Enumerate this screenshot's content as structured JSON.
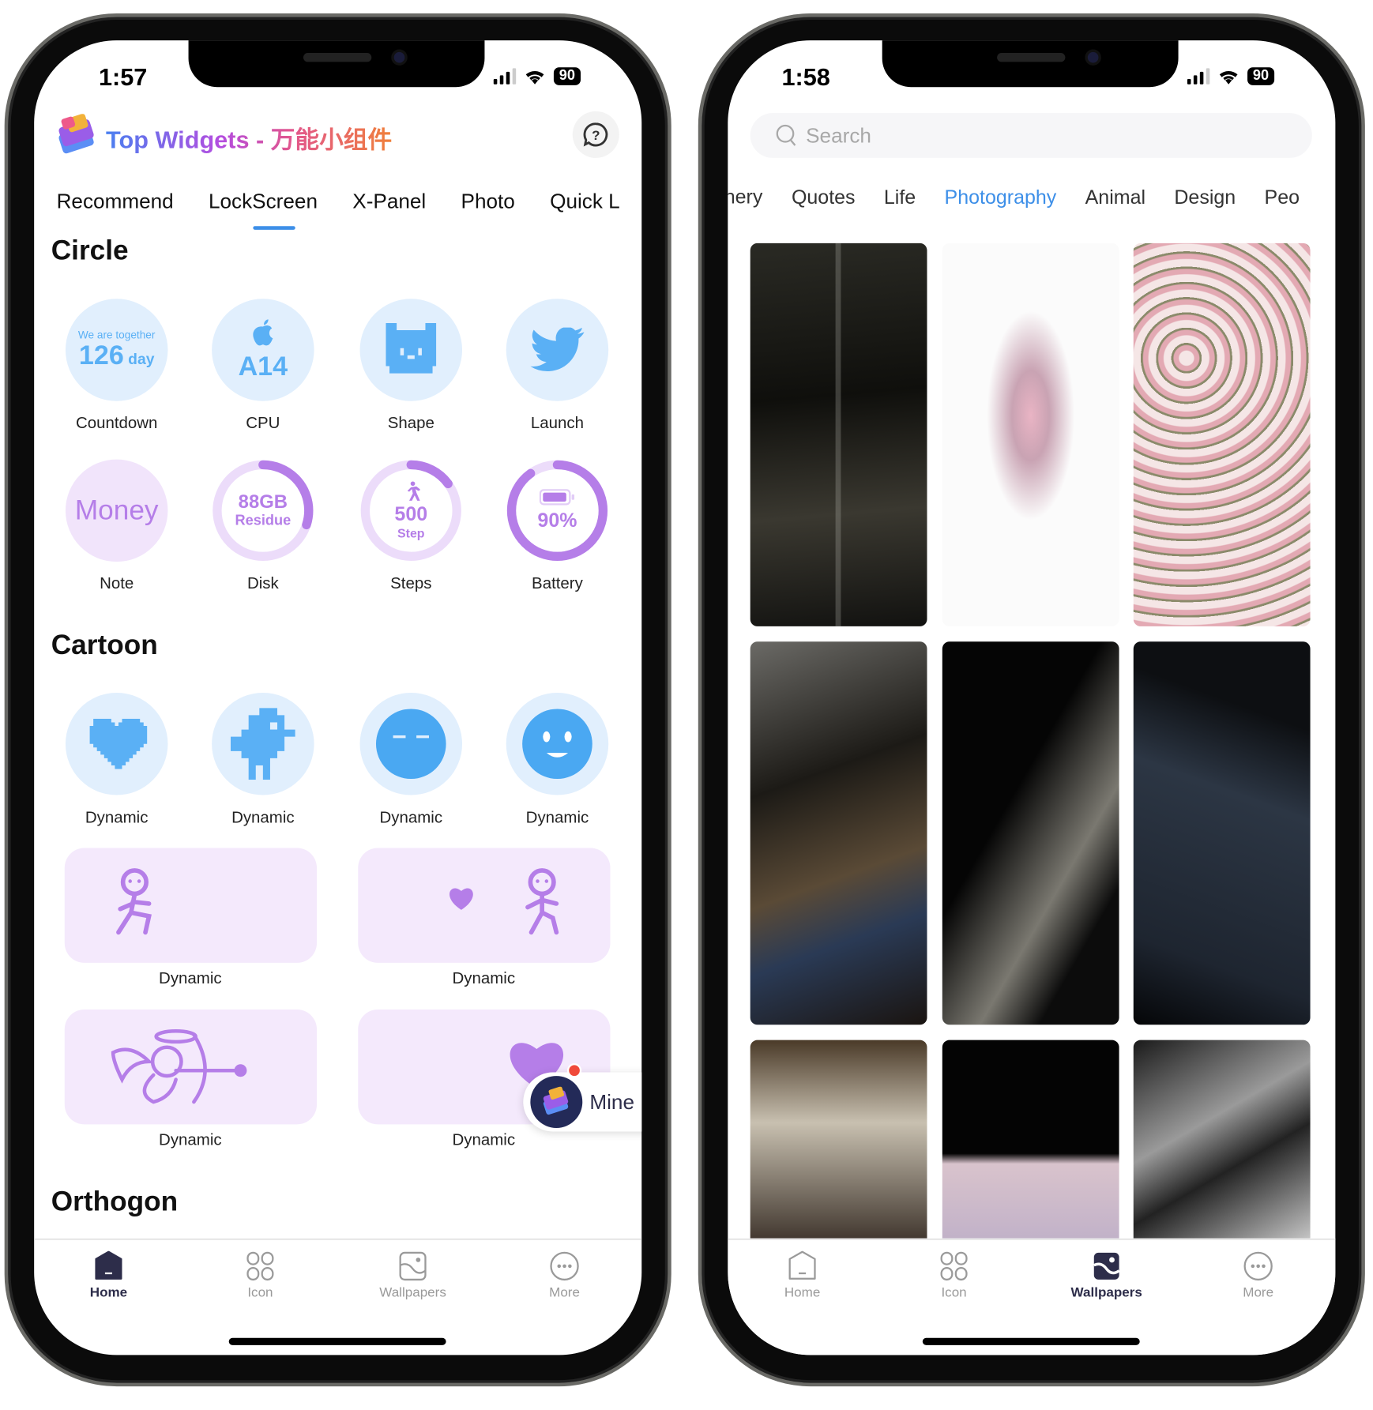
{
  "left": {
    "status": {
      "time": "1:57",
      "battery": "90"
    },
    "app_title": "Top Widgets - 万能小组件",
    "tabs": [
      {
        "label": "Recommend"
      },
      {
        "label": "LockScreen",
        "active": true
      },
      {
        "label": "X-Panel"
      },
      {
        "label": "Photo"
      },
      {
        "label": "Quick L"
      }
    ],
    "sections": {
      "circle": "Circle",
      "cartoon": "Cartoon",
      "orthogon": "Orthogon"
    },
    "circle_widgets": [
      {
        "label": "Countdown",
        "line1": "We are together",
        "value": "126",
        "unit": "day"
      },
      {
        "label": "CPU",
        "value": "A14",
        "icon": "apple-icon"
      },
      {
        "label": "Shape",
        "icon": "pixel-cat-icon"
      },
      {
        "label": "Launch",
        "icon": "twitter-bird-icon"
      },
      {
        "label": "Note",
        "value": "Money"
      },
      {
        "label": "Disk",
        "value": "88GB",
        "sub": "Residue",
        "progress": 0.3
      },
      {
        "label": "Steps",
        "value": "500",
        "sub": "Step",
        "progress": 0.15,
        "icon": "walking-icon"
      },
      {
        "label": "Battery",
        "value": "90%",
        "progress": 0.9,
        "icon": "battery-icon"
      }
    ],
    "cartoon_widgets": [
      {
        "label": "Dynamic",
        "icon": "pixel-heart-icon"
      },
      {
        "label": "Dynamic",
        "icon": "pixel-bird-icon"
      },
      {
        "label": "Dynamic",
        "icon": "sleepy-face-icon"
      },
      {
        "label": "Dynamic",
        "icon": "smiley-face-icon"
      }
    ],
    "wide_widgets": [
      {
        "label": "Dynamic",
        "icon": "dancing-figure-icon"
      },
      {
        "label": "Dynamic",
        "icon": "figure-heart-icon"
      },
      {
        "label": "Dynamic",
        "icon": "cupid-icon"
      },
      {
        "label": "Dynamic",
        "icon": "heart-icon"
      }
    ],
    "mine_label": "Mine",
    "nav": [
      {
        "label": "Home",
        "active": true
      },
      {
        "label": "Icon"
      },
      {
        "label": "Wallpapers"
      },
      {
        "label": "More"
      }
    ]
  },
  "right": {
    "status": {
      "time": "1:58",
      "battery": "90"
    },
    "search_placeholder": "Search",
    "categories": [
      {
        "label": "Scenery"
      },
      {
        "label": "Quotes"
      },
      {
        "label": "Life"
      },
      {
        "label": "Photography",
        "active": true
      },
      {
        "label": "Animal"
      },
      {
        "label": "Design"
      },
      {
        "label": "Peo"
      }
    ],
    "nav": [
      {
        "label": "Home"
      },
      {
        "label": "Icon"
      },
      {
        "label": "Wallpapers",
        "active": true
      },
      {
        "label": "More"
      }
    ]
  },
  "colors": {
    "accent": "#3d8fe8",
    "widget_blue": "#5ab0f5",
    "widget_purple": "#b57ee8",
    "nav_active": "#2d2d4a"
  }
}
